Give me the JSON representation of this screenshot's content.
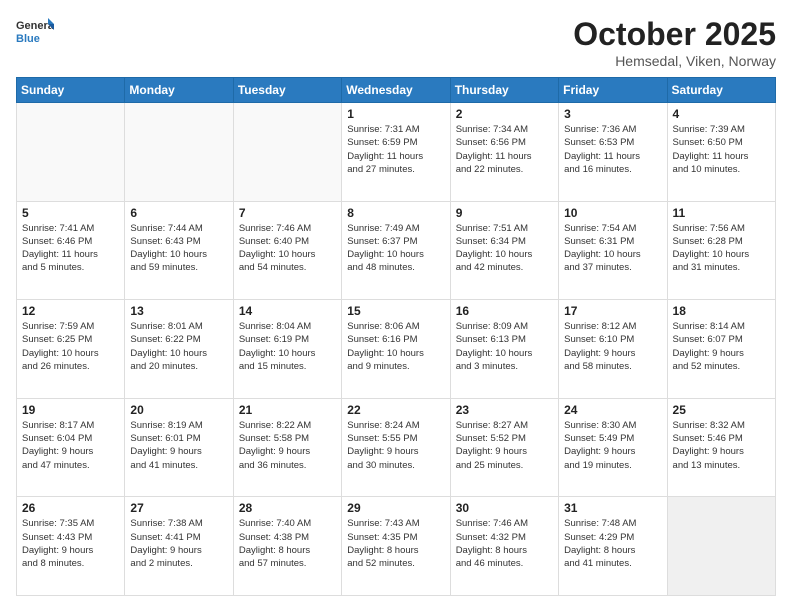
{
  "header": {
    "logo_general": "General",
    "logo_blue": "Blue",
    "month": "October 2025",
    "location": "Hemsedal, Viken, Norway"
  },
  "weekdays": [
    "Sunday",
    "Monday",
    "Tuesday",
    "Wednesday",
    "Thursday",
    "Friday",
    "Saturday"
  ],
  "weeks": [
    [
      {
        "day": "",
        "info": ""
      },
      {
        "day": "",
        "info": ""
      },
      {
        "day": "",
        "info": ""
      },
      {
        "day": "1",
        "info": "Sunrise: 7:31 AM\nSunset: 6:59 PM\nDaylight: 11 hours\nand 27 minutes."
      },
      {
        "day": "2",
        "info": "Sunrise: 7:34 AM\nSunset: 6:56 PM\nDaylight: 11 hours\nand 22 minutes."
      },
      {
        "day": "3",
        "info": "Sunrise: 7:36 AM\nSunset: 6:53 PM\nDaylight: 11 hours\nand 16 minutes."
      },
      {
        "day": "4",
        "info": "Sunrise: 7:39 AM\nSunset: 6:50 PM\nDaylight: 11 hours\nand 10 minutes."
      }
    ],
    [
      {
        "day": "5",
        "info": "Sunrise: 7:41 AM\nSunset: 6:46 PM\nDaylight: 11 hours\nand 5 minutes."
      },
      {
        "day": "6",
        "info": "Sunrise: 7:44 AM\nSunset: 6:43 PM\nDaylight: 10 hours\nand 59 minutes."
      },
      {
        "day": "7",
        "info": "Sunrise: 7:46 AM\nSunset: 6:40 PM\nDaylight: 10 hours\nand 54 minutes."
      },
      {
        "day": "8",
        "info": "Sunrise: 7:49 AM\nSunset: 6:37 PM\nDaylight: 10 hours\nand 48 minutes."
      },
      {
        "day": "9",
        "info": "Sunrise: 7:51 AM\nSunset: 6:34 PM\nDaylight: 10 hours\nand 42 minutes."
      },
      {
        "day": "10",
        "info": "Sunrise: 7:54 AM\nSunset: 6:31 PM\nDaylight: 10 hours\nand 37 minutes."
      },
      {
        "day": "11",
        "info": "Sunrise: 7:56 AM\nSunset: 6:28 PM\nDaylight: 10 hours\nand 31 minutes."
      }
    ],
    [
      {
        "day": "12",
        "info": "Sunrise: 7:59 AM\nSunset: 6:25 PM\nDaylight: 10 hours\nand 26 minutes."
      },
      {
        "day": "13",
        "info": "Sunrise: 8:01 AM\nSunset: 6:22 PM\nDaylight: 10 hours\nand 20 minutes."
      },
      {
        "day": "14",
        "info": "Sunrise: 8:04 AM\nSunset: 6:19 PM\nDaylight: 10 hours\nand 15 minutes."
      },
      {
        "day": "15",
        "info": "Sunrise: 8:06 AM\nSunset: 6:16 PM\nDaylight: 10 hours\nand 9 minutes."
      },
      {
        "day": "16",
        "info": "Sunrise: 8:09 AM\nSunset: 6:13 PM\nDaylight: 10 hours\nand 3 minutes."
      },
      {
        "day": "17",
        "info": "Sunrise: 8:12 AM\nSunset: 6:10 PM\nDaylight: 9 hours\nand 58 minutes."
      },
      {
        "day": "18",
        "info": "Sunrise: 8:14 AM\nSunset: 6:07 PM\nDaylight: 9 hours\nand 52 minutes."
      }
    ],
    [
      {
        "day": "19",
        "info": "Sunrise: 8:17 AM\nSunset: 6:04 PM\nDaylight: 9 hours\nand 47 minutes."
      },
      {
        "day": "20",
        "info": "Sunrise: 8:19 AM\nSunset: 6:01 PM\nDaylight: 9 hours\nand 41 minutes."
      },
      {
        "day": "21",
        "info": "Sunrise: 8:22 AM\nSunset: 5:58 PM\nDaylight: 9 hours\nand 36 minutes."
      },
      {
        "day": "22",
        "info": "Sunrise: 8:24 AM\nSunset: 5:55 PM\nDaylight: 9 hours\nand 30 minutes."
      },
      {
        "day": "23",
        "info": "Sunrise: 8:27 AM\nSunset: 5:52 PM\nDaylight: 9 hours\nand 25 minutes."
      },
      {
        "day": "24",
        "info": "Sunrise: 8:30 AM\nSunset: 5:49 PM\nDaylight: 9 hours\nand 19 minutes."
      },
      {
        "day": "25",
        "info": "Sunrise: 8:32 AM\nSunset: 5:46 PM\nDaylight: 9 hours\nand 13 minutes."
      }
    ],
    [
      {
        "day": "26",
        "info": "Sunrise: 7:35 AM\nSunset: 4:43 PM\nDaylight: 9 hours\nand 8 minutes."
      },
      {
        "day": "27",
        "info": "Sunrise: 7:38 AM\nSunset: 4:41 PM\nDaylight: 9 hours\nand 2 minutes."
      },
      {
        "day": "28",
        "info": "Sunrise: 7:40 AM\nSunset: 4:38 PM\nDaylight: 8 hours\nand 57 minutes."
      },
      {
        "day": "29",
        "info": "Sunrise: 7:43 AM\nSunset: 4:35 PM\nDaylight: 8 hours\nand 52 minutes."
      },
      {
        "day": "30",
        "info": "Sunrise: 7:46 AM\nSunset: 4:32 PM\nDaylight: 8 hours\nand 46 minutes."
      },
      {
        "day": "31",
        "info": "Sunrise: 7:48 AM\nSunset: 4:29 PM\nDaylight: 8 hours\nand 41 minutes."
      },
      {
        "day": "",
        "info": ""
      }
    ]
  ]
}
